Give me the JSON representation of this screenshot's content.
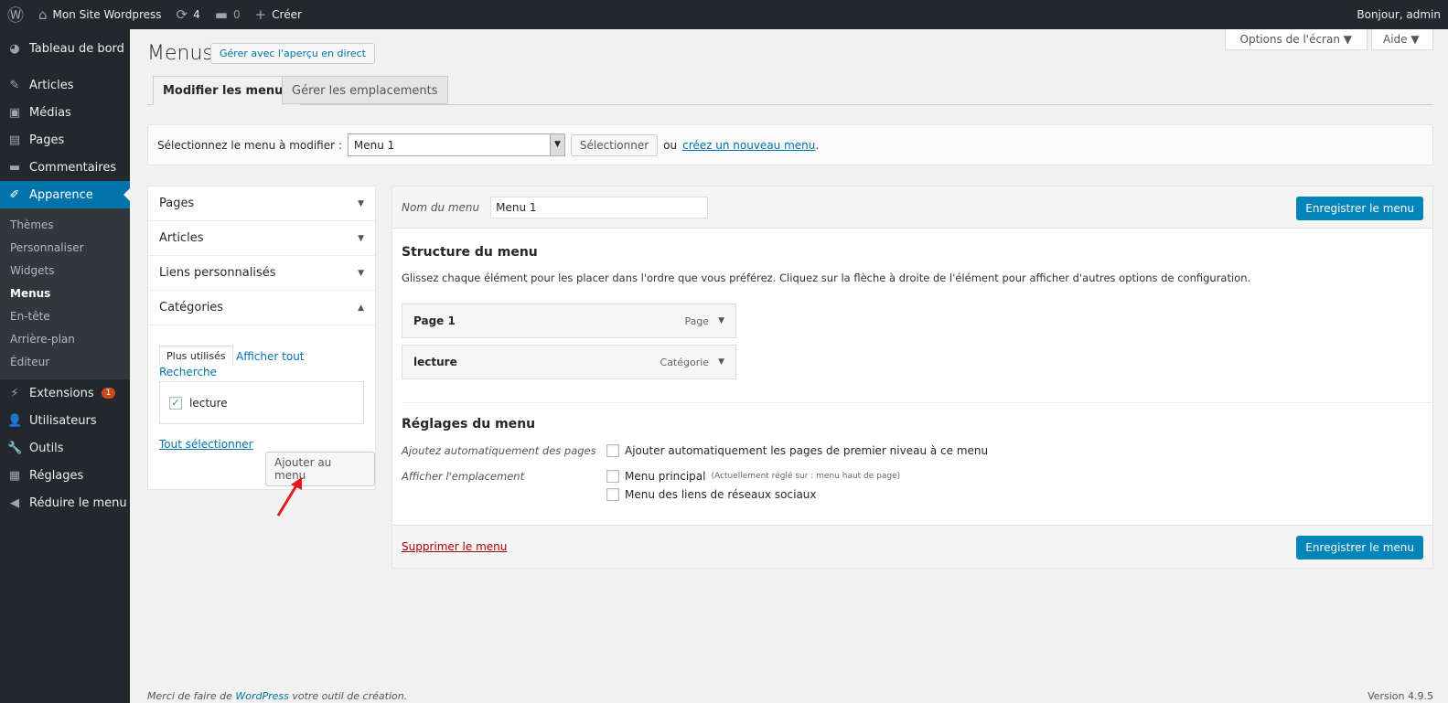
{
  "adminbar": {
    "site": "Mon Site Wordpress",
    "updates": "4",
    "comments": "0",
    "new": "Créer",
    "greeting": "Bonjour, admin"
  },
  "sidebar": {
    "items": [
      {
        "label": "Tableau de bord",
        "icon": "dashboard-icon",
        "g": "◕"
      },
      {
        "label": "Articles",
        "icon": "pin-icon",
        "g": "✎"
      },
      {
        "label": "Médias",
        "icon": "media-icon",
        "g": "▣"
      },
      {
        "label": "Pages",
        "icon": "pages-icon",
        "g": "▤"
      },
      {
        "label": "Commentaires",
        "icon": "comment-icon",
        "g": "▬"
      },
      {
        "label": "Apparence",
        "icon": "brush-icon",
        "g": "✐"
      }
    ],
    "submenu": [
      "Thèmes",
      "Personnaliser",
      "Widgets",
      "Menus",
      "En-tête",
      "Arrière-plan",
      "Éditeur"
    ],
    "items2": [
      {
        "label": "Extensions",
        "icon": "plugin-icon",
        "g": "⚡",
        "badge": "1"
      },
      {
        "label": "Utilisateurs",
        "icon": "users-icon",
        "g": "👤"
      },
      {
        "label": "Outils",
        "icon": "tools-icon",
        "g": "🔧"
      },
      {
        "label": "Réglages",
        "icon": "settings-icon",
        "g": "▦"
      },
      {
        "label": "Réduire le menu",
        "icon": "collapse-icon",
        "g": "◀"
      }
    ]
  },
  "header": {
    "title": "Menus",
    "live": "Gérer avec l'aperçu en direct",
    "screen_options": "Options de l'écran",
    "help": "Aide"
  },
  "tabs": [
    "Modifier les menus",
    "Gérer les emplacements"
  ],
  "select": {
    "label": "Sélectionnez le menu à modifier :",
    "value": "Menu 1",
    "button": "Sélectionner",
    "or": "ou",
    "create": "créez un nouveau menu",
    "dot": "."
  },
  "accordion": [
    "Pages",
    "Articles",
    "Liens personnalisés",
    "Catégories"
  ],
  "categories": {
    "tabs": [
      "Plus utilisés",
      "Afficher tout",
      "Recherche"
    ],
    "item": "lecture",
    "checked": true,
    "select_all": "Tout sélectionner",
    "add": "Ajouter au menu"
  },
  "menu": {
    "name_label": "Nom du menu",
    "name": "Menu 1",
    "save": "Enregistrer le menu",
    "structure_title": "Structure du menu",
    "structure_desc": "Glissez chaque élément pour les placer dans l'ordre que vous préférez. Cliquez sur la flèche à droite de l'élément pour afficher d'autres options de configuration.",
    "items": [
      {
        "title": "Page 1",
        "type": "Page"
      },
      {
        "title": "lecture",
        "type": "Catégorie"
      }
    ],
    "settings_title": "Réglages du menu",
    "auto_label": "Ajoutez automatiquement des pages",
    "auto_opt": "Ajouter automatiquement les pages de premier niveau à ce menu",
    "loc_label": "Afficher l'emplacement",
    "loc1": "Menu principal",
    "loc1_note": "(Actuellement réglé sur : menu haut de page)",
    "loc2": "Menu des liens de réseaux sociaux",
    "delete": "Supprimer le menu"
  },
  "footer": {
    "pre": "Merci de faire de ",
    "wp": "WordPress",
    "post": " votre outil de création.",
    "version": "Version 4.9.5"
  },
  "colors": {
    "accent": "#0073aa",
    "adminbar": "#23282d",
    "arrow": "#e0191c"
  }
}
